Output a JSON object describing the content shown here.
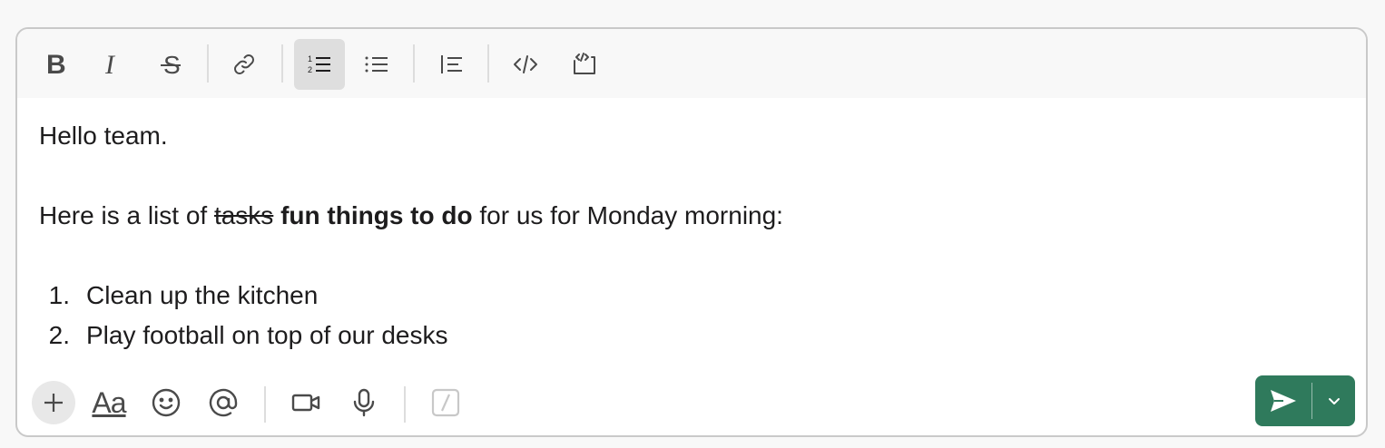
{
  "toolbar": {
    "buttons": [
      {
        "name": "bold-icon",
        "active": false
      },
      {
        "name": "italic-icon",
        "active": false
      },
      {
        "name": "strikethrough-icon",
        "active": false
      },
      {
        "name": "link-icon",
        "active": false
      },
      {
        "name": "ordered-list-icon",
        "active": true
      },
      {
        "name": "bulleted-list-icon",
        "active": false
      },
      {
        "name": "blockquote-icon",
        "active": false
      },
      {
        "name": "code-icon",
        "active": false
      },
      {
        "name": "code-block-icon",
        "active": false
      }
    ]
  },
  "editor": {
    "line1": "Hello team.",
    "line2_prefix": "Here is a list of ",
    "line2_struck": "tasks",
    "line2_space": " ",
    "line2_bold": "fun things to do",
    "line2_suffix": " for us for Monday morning:",
    "list": [
      {
        "number": "1.",
        "text": "Clean up the kitchen"
      },
      {
        "number": "2.",
        "text": "Play football on top of our desks"
      }
    ]
  },
  "bottombar": {
    "format_label": "Aa",
    "icons": [
      "plus-icon",
      "format-text-icon",
      "emoji-icon",
      "mention-icon",
      "video-icon",
      "microphone-icon",
      "slash-command-icon"
    ]
  },
  "colors": {
    "send_button": "#2f7a5c",
    "toolbar_bg": "#f8f8f8",
    "active_button_bg": "#dedede",
    "text": "#1d1c1d"
  }
}
